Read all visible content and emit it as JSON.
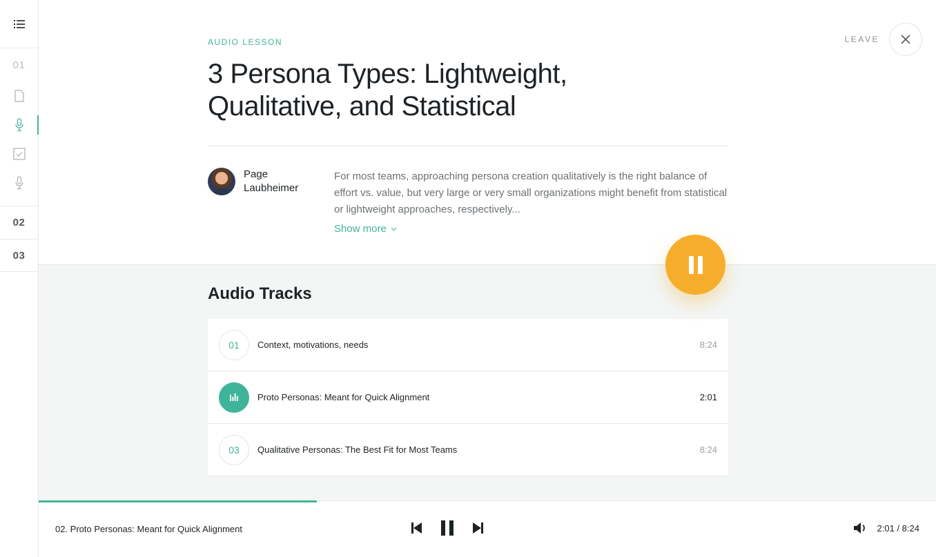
{
  "sidebar": {
    "modules": [
      "01",
      "02",
      "03"
    ]
  },
  "header": {
    "leave_label": "LEAVE"
  },
  "lesson": {
    "eyebrow": "AUDIO LESSON",
    "title": "3 Persona Types: Lightweight, Qualitative, and Statistical",
    "author": "Page Laubheimer",
    "description": "For most teams, approaching persona creation qualitatively is the right balance of effort vs. value, but very large or very small organizations might benefit from statistical or lightweight approaches, respectively...",
    "show_more": "Show more"
  },
  "tracks": {
    "heading": "Audio Tracks",
    "items": [
      {
        "num": "01",
        "title": "Context, motivations, needs",
        "duration": "8:24"
      },
      {
        "num": "02",
        "title": "Proto Personas:  Meant for Quick Alignment",
        "duration": "2:01"
      },
      {
        "num": "03",
        "title": "Qualitative Personas: The Best Fit for Most Teams",
        "duration": "8:24"
      }
    ]
  },
  "player": {
    "now_playing": "02. Proto Personas:  Meant for Quick Alignment",
    "time": "2:01 / 8:24",
    "progress": 0.31
  },
  "colors": {
    "accent": "#3fb49a",
    "play_button": "#f7ad2c"
  }
}
